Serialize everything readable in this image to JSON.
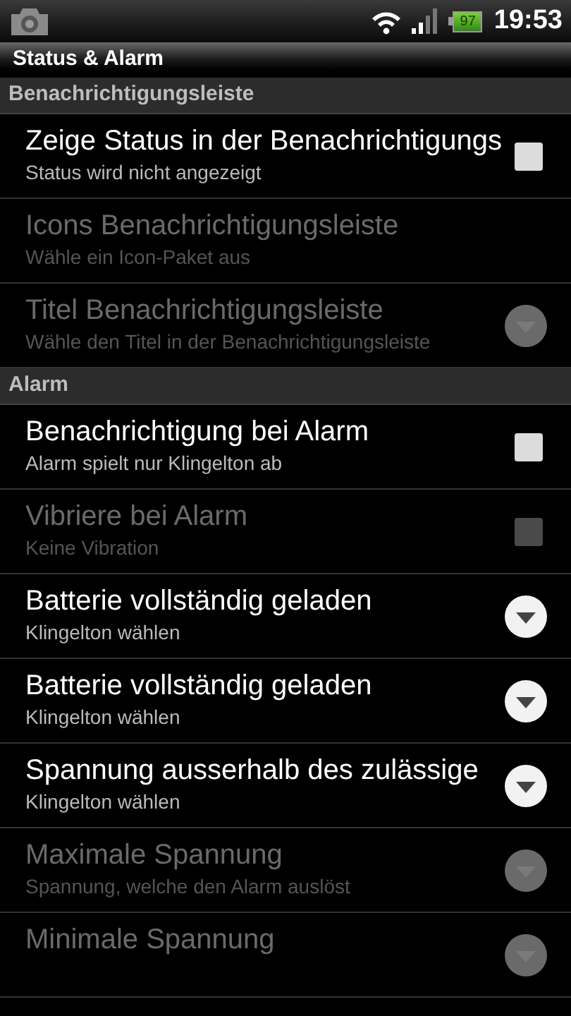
{
  "status_bar": {
    "battery": "97",
    "time": "19:53"
  },
  "title": "Status & Alarm",
  "sections": [
    {
      "header": "Benachrichtigungsleiste",
      "items": [
        {
          "kind": "checkbox",
          "title": "Zeige Status in der Benachrichtigungs",
          "summary": "Status wird nicht angezeigt",
          "disabled": false,
          "checked": false
        },
        {
          "kind": "plain",
          "title": "Icons Benachrichtigungsleiste",
          "summary": "Wähle ein Icon-Paket aus",
          "disabled": true
        },
        {
          "kind": "dropdown",
          "title": "Titel Benachrichtigungsleiste",
          "summary": "Wähle den Titel in der Benachrichtigungsleiste",
          "disabled": true
        }
      ]
    },
    {
      "header": "Alarm",
      "items": [
        {
          "kind": "checkbox",
          "title": "Benachrichtigung bei Alarm",
          "summary": "Alarm spielt nur Klingelton ab",
          "disabled": false,
          "checked": false
        },
        {
          "kind": "checkbox",
          "title": "Vibriere bei Alarm",
          "summary": "Keine Vibration",
          "disabled": true,
          "checked": false
        },
        {
          "kind": "dropdown",
          "title": "Batterie vollständig geladen",
          "summary": "Klingelton wählen",
          "disabled": false
        },
        {
          "kind": "dropdown",
          "title": "Batterie vollständig geladen",
          "summary": "Klingelton wählen",
          "disabled": false
        },
        {
          "kind": "dropdown",
          "title": "Spannung ausserhalb des zulässige",
          "summary": "Klingelton wählen",
          "disabled": false
        },
        {
          "kind": "dropdown",
          "title": "Maximale Spannung",
          "summary": "Spannung, welche den Alarm auslöst",
          "disabled": true
        },
        {
          "kind": "dropdown",
          "title": "Minimale Spannung",
          "disabled": true
        }
      ]
    }
  ]
}
